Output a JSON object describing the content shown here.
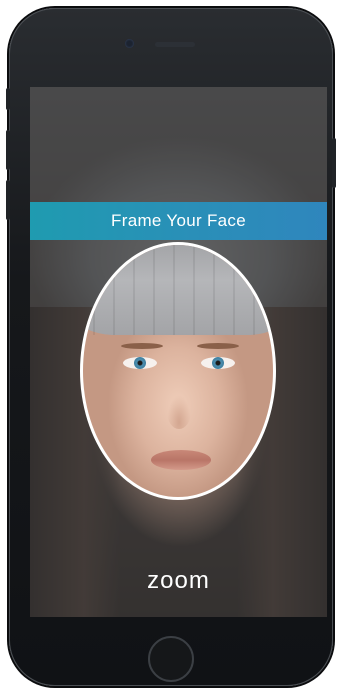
{
  "screen": {
    "banner_text": "Frame Your Face",
    "brand_text": "zoom"
  },
  "colors": {
    "banner_start": "#1f9bb0",
    "banner_end": "#2f86bd",
    "frame_border": "#ffffff",
    "phone_body": "#16181b"
  },
  "icons": {
    "front_camera": "camera-icon",
    "speaker": "speaker-icon",
    "home": "home-button-icon"
  }
}
